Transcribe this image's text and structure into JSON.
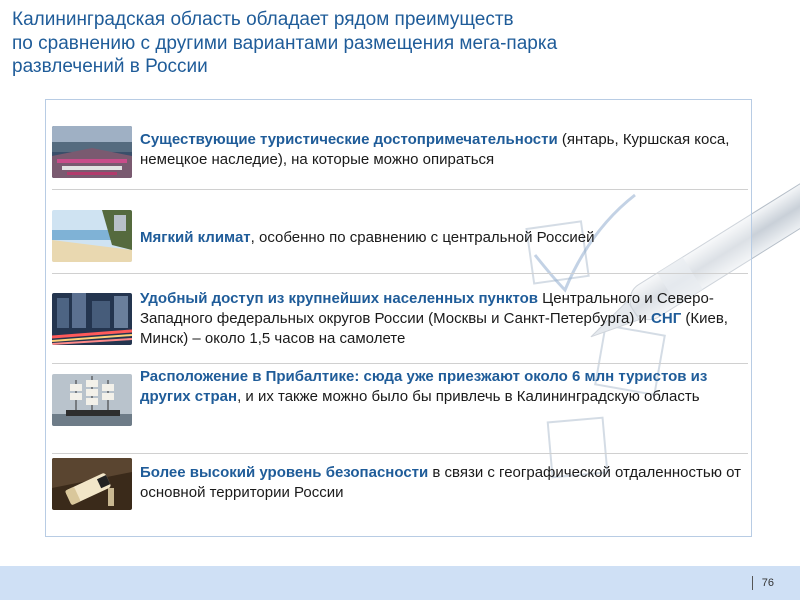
{
  "title": {
    "line1": "Калининградская область обладает рядом преимуществ",
    "line2": "по сравнению с другими вариантами размещения мега-парка",
    "line3": "развлечений в России"
  },
  "items": [
    {
      "bold": "Существующие туристические достопримечательности",
      "rest": " (янтарь, Куршская коса, немецкое наследие), на которые можно опираться"
    },
    {
      "bold": "Мягкий климат",
      "rest": ", особенно по сравнению с центральной Россией"
    },
    {
      "bold": "Удобный доступ из крупнейших населенных пунктов",
      "rest": " Центрального и Северо-Западного федеральных округов России (Москвы и Санкт-Петербурга) и ",
      "bold2": "СНГ",
      "rest2": " (Киев, Минск) – около 1,5 часов на самолете"
    },
    {
      "bold": "Расположение в Прибалтике: сюда уже приезжают около 6 млн туристов из других стран",
      "rest": ", и их также можно было бы привлечь в Калининградскую область"
    },
    {
      "bold": "Более высокий уровень безопасности",
      "rest": " в связи с географической отдаленностью от основной территории России"
    }
  ],
  "page_number": "76"
}
